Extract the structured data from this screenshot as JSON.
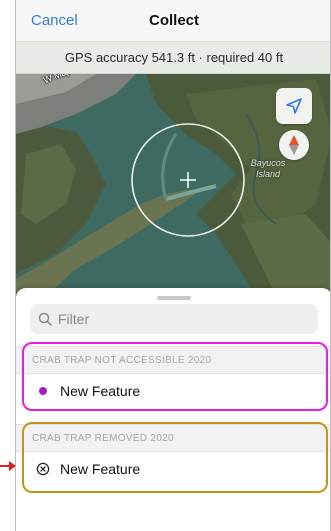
{
  "nav": {
    "cancel_label": "Cancel",
    "title": "Collect"
  },
  "gps": {
    "text": "GPS accuracy 541.3 ft · required 40 ft"
  },
  "map": {
    "street_label": "W Maple St",
    "island_label": "Bayucos Island",
    "icons": [
      "location-arrow-icon",
      "compass-icon",
      "crosshair-icon"
    ]
  },
  "sheet": {
    "filter_placeholder": "Filter",
    "groups": [
      {
        "header": "CRAB TRAP NOT ACCESSIBLE 2020",
        "item_label": "New Feature",
        "icon": "purple-dot-icon",
        "highlight_color": "#e81de0"
      },
      {
        "header": "CRAB TRAP REMOVED 2020",
        "item_label": "New Feature",
        "icon": "circle-x-icon",
        "highlight_color": "#c69417"
      }
    ]
  },
  "colors": {
    "accent": "#2f7be5",
    "purple_dot": "#a21fc2",
    "arrow": "#e02020"
  }
}
